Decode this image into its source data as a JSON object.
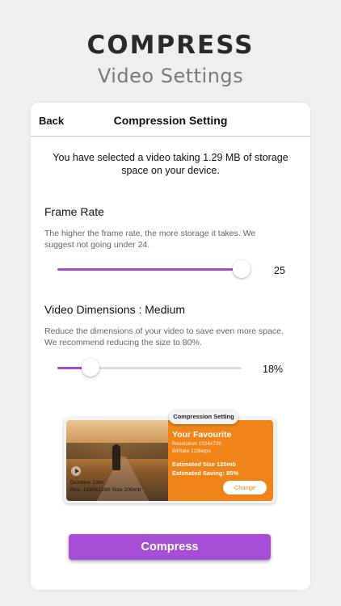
{
  "hero": {
    "title": "COMPRESS",
    "subtitle": "Video Settings"
  },
  "nav": {
    "back_label": "Back",
    "title": "Compression Setting"
  },
  "intro": "You have selected a video taking 1.29 MB of storage space on your device.",
  "frame_rate": {
    "title": "Frame Rate",
    "description": "The higher the frame rate, the more storage it takes. We suggest not going under 24.",
    "value_label": "25",
    "slider_fraction": 1.0
  },
  "dimensions": {
    "title": "Video Dimensions : Medium",
    "description": "Reduce the dimensions of your video to save even more space. We recommend reducing the size to 80%.",
    "value_label": "18%",
    "slider_fraction": 0.18
  },
  "preview_card": {
    "badge": "Compression Setting",
    "video_duration": "Duration 12m",
    "video_res_size": "Res. 1280x1280   Size 200mb",
    "panel_title": "Your Favourite",
    "panel_resolution": "Resolution 1024x720",
    "panel_bitrate": "BitRate 128kbps",
    "estimated_size": "Estimated Size 120mb",
    "estimated_saving": "Estimated Saving: 85%",
    "change_label": "Change"
  },
  "compress_label": "Compress",
  "colors": {
    "accent": "#a64fd6",
    "orange": "#f08318",
    "background": "#efefef"
  }
}
